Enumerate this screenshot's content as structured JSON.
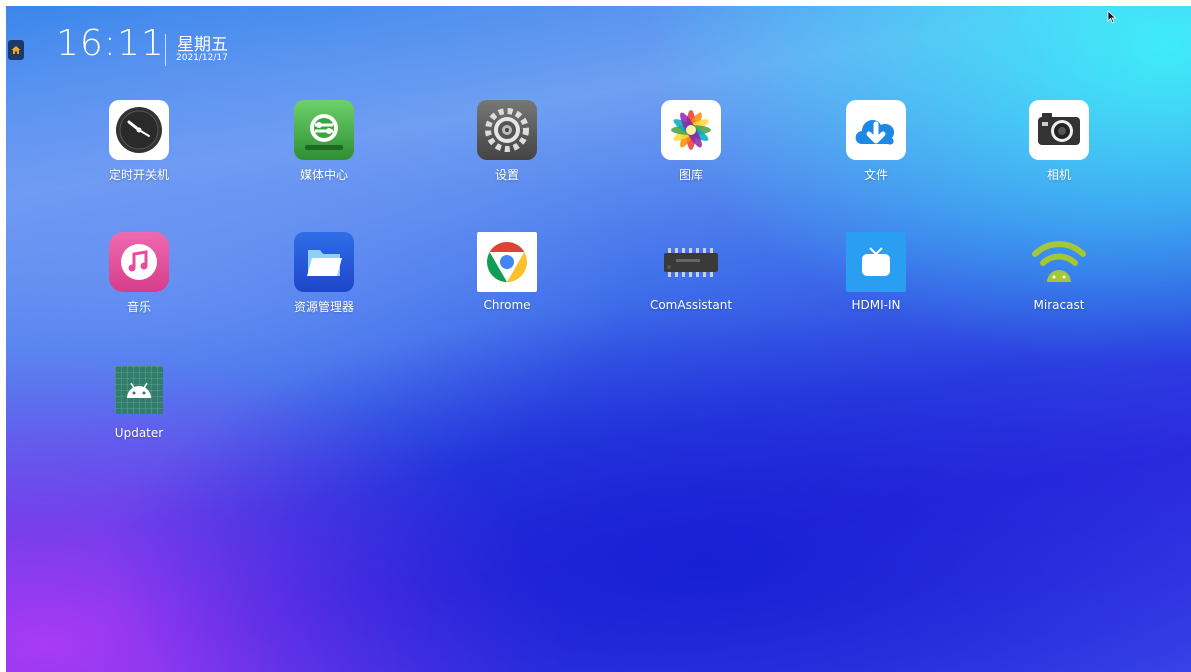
{
  "status": {
    "time": "16:11",
    "weekday": "星期五",
    "date": "2021/12/17"
  },
  "apps": [
    {
      "label": "定时开关机",
      "icon": "clock-icon"
    },
    {
      "label": "媒体中心",
      "icon": "media-center-icon"
    },
    {
      "label": "设置",
      "icon": "settings-icon"
    },
    {
      "label": "图库",
      "icon": "gallery-icon"
    },
    {
      "label": "文件",
      "icon": "cloud-download-icon"
    },
    {
      "label": "相机",
      "icon": "camera-icon"
    },
    {
      "label": "音乐",
      "icon": "music-icon"
    },
    {
      "label": "资源管理器",
      "icon": "folder-icon"
    },
    {
      "label": "Chrome",
      "icon": "chrome-icon"
    },
    {
      "label": "ComAssistant",
      "icon": "chip-icon"
    },
    {
      "label": "HDMI-IN",
      "icon": "tv-icon"
    },
    {
      "label": "Miracast",
      "icon": "wifi-android-icon"
    },
    {
      "label": "Updater",
      "icon": "android-icon"
    }
  ],
  "colors": {
    "clock_bg": "#ffffff",
    "media_center": "#3aa63e",
    "settings": "#5b5b5b",
    "files": "#1e88e5",
    "music": "#e94b9c",
    "folder": "#2457d6",
    "hdmi": "#2a9ff2",
    "updater": "#2f7d6a"
  }
}
